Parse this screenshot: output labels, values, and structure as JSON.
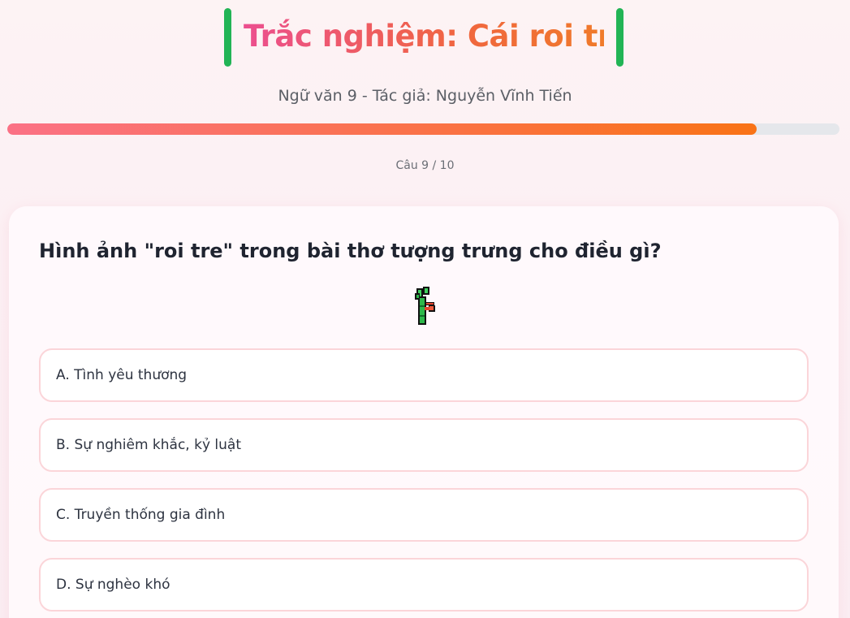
{
  "header": {
    "title": "Trắc nghiệm: Cái roi tre",
    "subtitle": "Ngữ văn 9 - Tác giả: Nguyễn Vĩnh Tiến",
    "accent_bar_color": "#22b455",
    "title_gradient": [
      "#ec4f8f",
      "#f07a2a"
    ]
  },
  "progress": {
    "fraction": 0.9,
    "counter_text": "Câu 9 / 10",
    "fill_gradient": [
      "#fb7185",
      "#f97316"
    ]
  },
  "question": {
    "text": "Hình ảnh \"roi tre\" trong bài thơ tượng trưng cho điều gì?",
    "illustration_icon": "bamboo-stick-icon",
    "options": [
      {
        "label": "A. Tình yêu thương"
      },
      {
        "label": "B. Sự nghiêm khắc, kỷ luật"
      },
      {
        "label": "C. Truyền thống gia đình"
      },
      {
        "label": "D. Sự nghèo khó"
      }
    ]
  }
}
